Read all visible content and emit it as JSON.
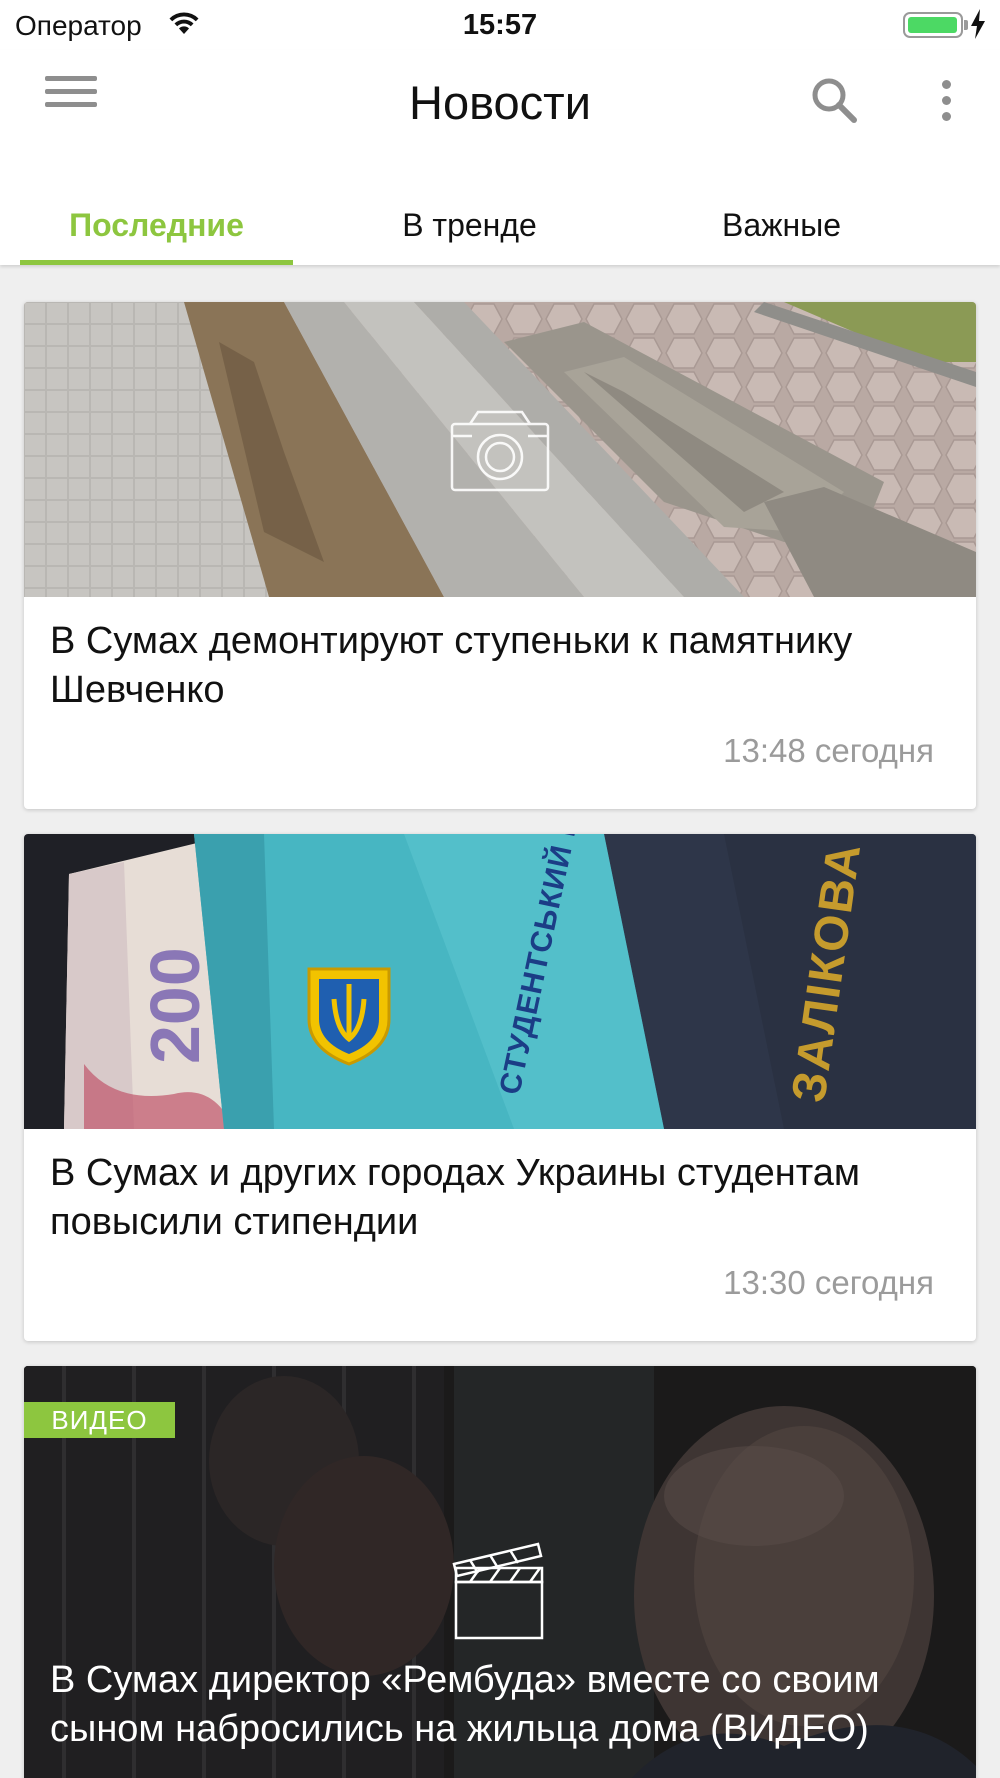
{
  "status_bar": {
    "carrier": "Оператор",
    "time": "15:57",
    "battery_level": 1.0,
    "battery_color": "#4cd964"
  },
  "header": {
    "title": "Новости",
    "menu_icon": "hamburger-menu-icon",
    "search_icon": "search-icon",
    "more_icon": "more-vertical-icon"
  },
  "tabs": [
    {
      "label": "Последние",
      "active": true
    },
    {
      "label": "В тренде",
      "active": false
    },
    {
      "label": "Важные",
      "active": false
    }
  ],
  "accent_color": "#8dc63f",
  "articles": [
    {
      "title": "В Сумах демонтируют ступеньки к памятнику Шевченко",
      "time": "13:48 сегодня",
      "overlay_icon": "camera-icon"
    },
    {
      "title": "В Сумах и других городах Украины студентам повысили стипендии",
      "time": "13:30 сегодня",
      "image_text": {
        "banknote": "200",
        "card": "СТУДЕНТСЬКИЙ КВИТОК",
        "book": "ЗАЛІКОВА КНИЖКА"
      }
    },
    {
      "badge": "ВИДЕО",
      "title": "В Сумах директор «Рембуда» вместе со своим сыном набросились на жильца дома (ВИДЕО)",
      "overlay_icon": "clapperboard-icon"
    }
  ]
}
